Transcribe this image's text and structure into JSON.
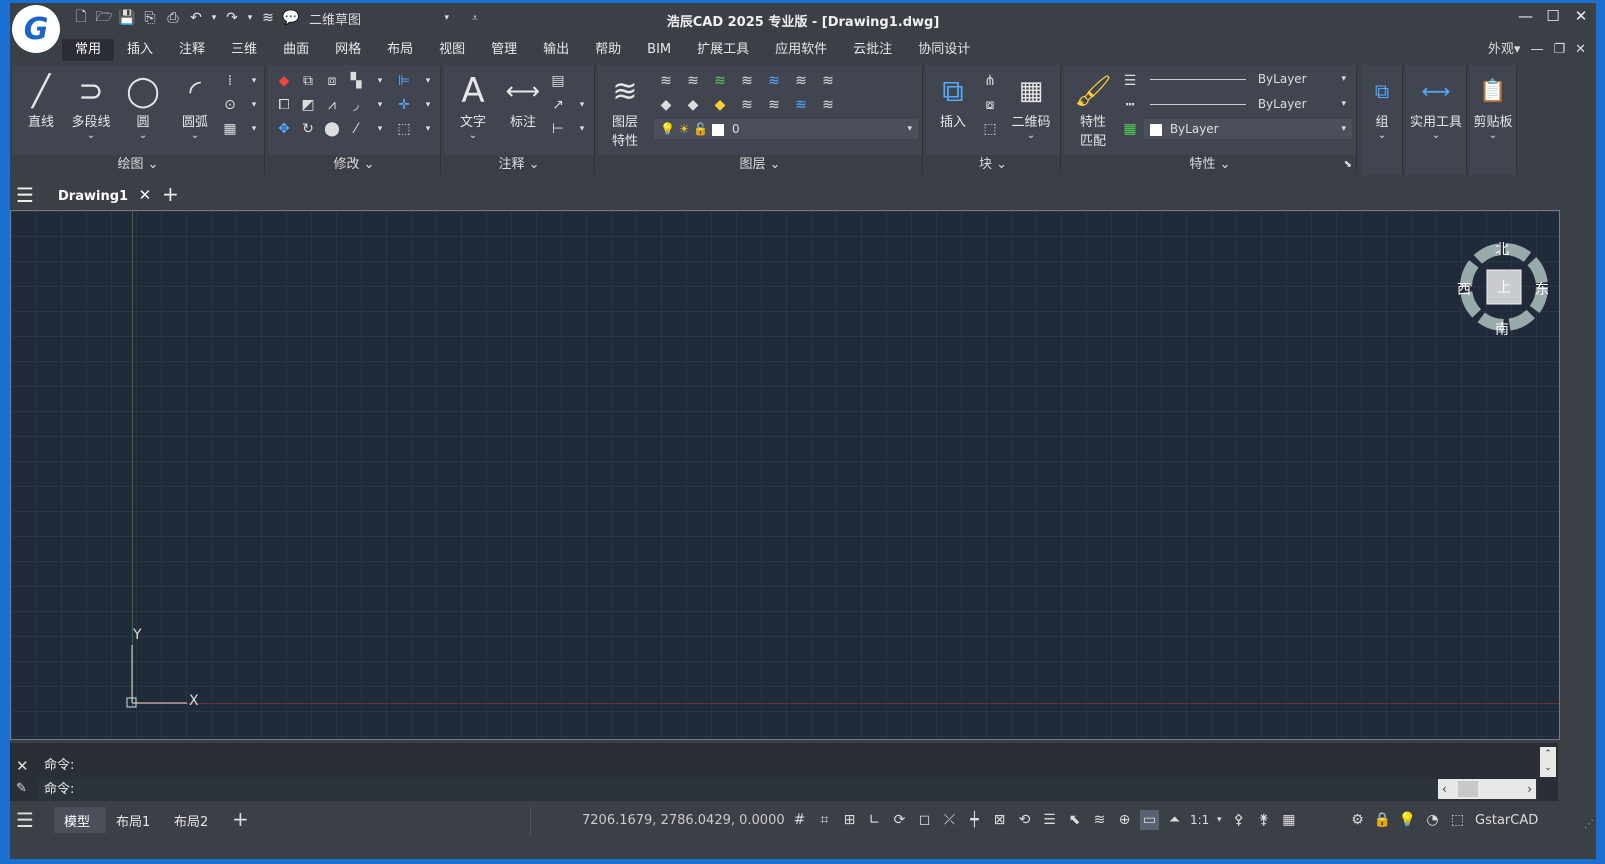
{
  "titlebar": {
    "title": "浩辰CAD 2025 专业版 - [Drawing1.dwg]",
    "workspace": "二维草图",
    "logo_letter": "G"
  },
  "menu": {
    "tabs": [
      "常用",
      "插入",
      "注释",
      "三维",
      "曲面",
      "网格",
      "布局",
      "视图",
      "管理",
      "输出",
      "帮助",
      "BIM",
      "扩展工具",
      "应用软件",
      "云批注",
      "协同设计"
    ],
    "appearance": "外观"
  },
  "ribbon": {
    "draw": {
      "title": "绘图",
      "line": "直线",
      "polyline": "多段线",
      "circle": "圆",
      "arc": "圆弧"
    },
    "modify": {
      "title": "修改"
    },
    "annotate": {
      "title": "注释",
      "text": "文字",
      "dim": "标注"
    },
    "layers": {
      "title": "图层",
      "props_line1": "图层",
      "props_line2": "特性",
      "current_layer": "0"
    },
    "block": {
      "title": "块",
      "insert": "插入",
      "qrcode": "二维码"
    },
    "properties": {
      "title": "特性",
      "match_line1": "特性",
      "match_line2": "匹配",
      "bylayer1": "ByLayer",
      "bylayer2": "ByLayer",
      "bylayer3": "ByLayer"
    },
    "group": {
      "label": "组"
    },
    "utilities": {
      "label": "实用工具"
    },
    "clipboard": {
      "label": "剪贴板"
    }
  },
  "doctab": {
    "name": "Drawing1"
  },
  "compass": {
    "north": "北",
    "south": "南",
    "east": "东",
    "west": "西",
    "top": "上"
  },
  "ucs": {
    "x": "X",
    "y": "Y"
  },
  "command": {
    "prompt1": "命令:",
    "prompt2": "命令:"
  },
  "status": {
    "layouts": [
      "模型",
      "布局1",
      "布局2"
    ],
    "coords": "7206.1679, 2786.0429, 0.0000",
    "scale": "1:1",
    "app": "GstarCAD"
  },
  "colors": {
    "canvas": "#212a38",
    "grid": "#2b3545",
    "accent": "#1d63c8"
  }
}
